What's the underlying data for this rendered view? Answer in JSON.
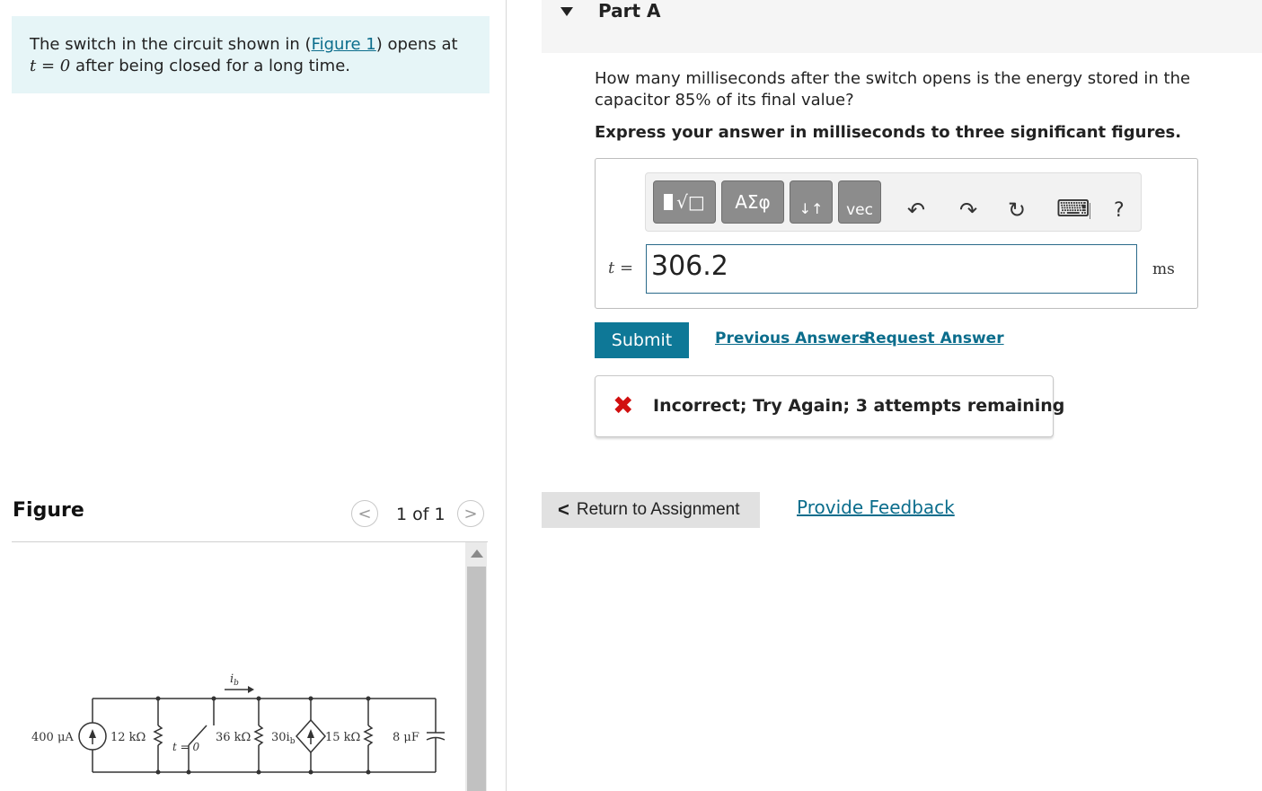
{
  "problem": {
    "text_before": "The switch in the circuit shown in (",
    "figure_link": "Figure 1",
    "text_after": ") opens at",
    "math_t0": "t = 0",
    "text_line2": " after being closed for a long time."
  },
  "figure": {
    "title": "Figure",
    "prev_symbol": "<",
    "next_symbol": ">",
    "page_count": "1 of 1"
  },
  "circuit": {
    "source_label": "400 μA",
    "r1_label": "12 kΩ",
    "switch_label": "t = 0",
    "r2_label": "36 kΩ",
    "dep_source_label": "30i",
    "dep_source_sub": "b",
    "current_label": "i",
    "current_sub": "b",
    "r3_label": "15 kΩ",
    "cap_label": "8 μF"
  },
  "part": {
    "title": "Part A",
    "question_line1": "How many milliseconds after the switch opens is the energy stored in the",
    "question_line2_pre": "capacitor 85",
    "question_percent": "%",
    "question_line2_post": " of its final value?",
    "instruction": "Express your answer in milliseconds to three significant figures."
  },
  "toolbar": {
    "templates_label": "√□",
    "greek_label": "ΑΣφ",
    "arrows_label": "↓↑",
    "vec_label": "vec",
    "undo_icon": "↶",
    "redo_icon": "↷",
    "reset_icon": "↻",
    "keyboard_icon": "⌨",
    "help_label": "?"
  },
  "answer": {
    "variable": "t",
    "equals": " = ",
    "value": "306.2",
    "unit": "ms"
  },
  "actions": {
    "submit_label": "Submit",
    "previous_answers_label": "Previous Answers",
    "request_answer_label": "Request Answer"
  },
  "feedback": {
    "icon": "✖",
    "message": "Incorrect; Try Again; 3 attempts remaining"
  },
  "footer": {
    "return_label": "Return to Assignment",
    "return_chevron": "<",
    "provide_feedback_label": "Provide Feedback"
  },
  "colors": {
    "accent": "#0e7897",
    "link": "#0b6d8c",
    "problem_bg": "#e6f5f7",
    "error": "#d10f0f"
  }
}
